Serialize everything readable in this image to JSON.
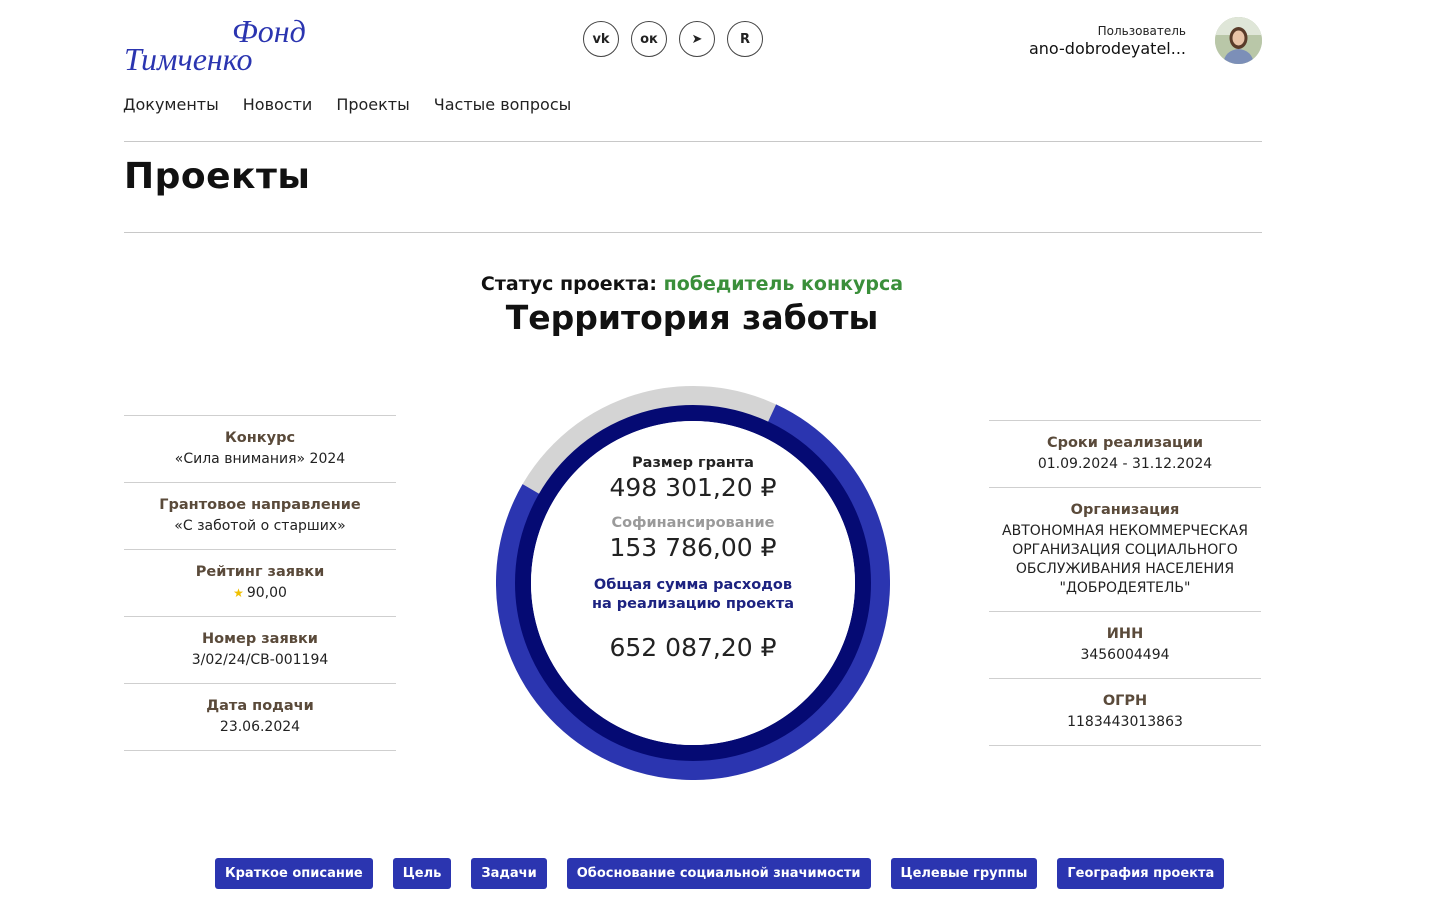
{
  "header": {
    "logo_line1": "Фонд",
    "logo_line2": "Тимченко",
    "socials": [
      {
        "icon": "vk-icon",
        "glyph": "vk"
      },
      {
        "icon": "ok-icon",
        "glyph": "ок"
      },
      {
        "icon": "telegram-icon",
        "glyph": "➤"
      },
      {
        "icon": "rutube-icon",
        "glyph": "R"
      }
    ],
    "user_label": "Пользователь",
    "user_name": "ano-dobrodeyatel..."
  },
  "nav": [
    "Документы",
    "Новости",
    "Проекты",
    "Частые вопросы"
  ],
  "page_title": "Проекты",
  "status": {
    "label": "Статус проекта:",
    "value": "победитель конкурса",
    "value_color": "#3a8f3a"
  },
  "project_title": "Территория заботы",
  "left_info": [
    {
      "k": "Конкурс",
      "v": "«Сила внимания» 2024"
    },
    {
      "k": "Грантовое направление",
      "v": "«С заботой о старших»"
    },
    {
      "k": "Рейтинг заявки",
      "v": "90,00"
    },
    {
      "k": "Номер заявки",
      "v": "3/02/24/СВ-001194"
    },
    {
      "k": "Дата подачи",
      "v": "23.06.2024"
    }
  ],
  "right_info": [
    {
      "k": "Сроки реализации",
      "v": "01.09.2024 - 31.12.2024"
    },
    {
      "k": "Организация",
      "v": "АВТОНОМНАЯ НЕКОММЕРЧЕСКАЯ ОРГАНИЗАЦИЯ СОЦИАЛЬНОГО ОБСЛУЖИВАНИЯ НАСЕЛЕНИЯ \"ДОБРОДЕЯТЕЛЬ\""
    },
    {
      "k": "ИНН",
      "v": "3456004494"
    },
    {
      "k": "ОГРН",
      "v": "1183443013863"
    }
  ],
  "finance": {
    "grant_label": "Размер гранта",
    "grant_value": "498 301,20 ₽",
    "cofin_label": "Софинансирование",
    "cofin_value": "153 786,00 ₽",
    "total_label": "Общая сумма расходов на реализацию проекта",
    "total_value": "652 087,20 ₽",
    "grant_share": 0.764,
    "colors": {
      "grant": "#2b35b0",
      "cofin": "#d4d4d4",
      "inner": "#050a73"
    }
  },
  "tabs": [
    "Краткое описание",
    "Цель",
    "Задачи",
    "Обоснование социальной значимости",
    "Целевые группы",
    "География проекта"
  ]
}
